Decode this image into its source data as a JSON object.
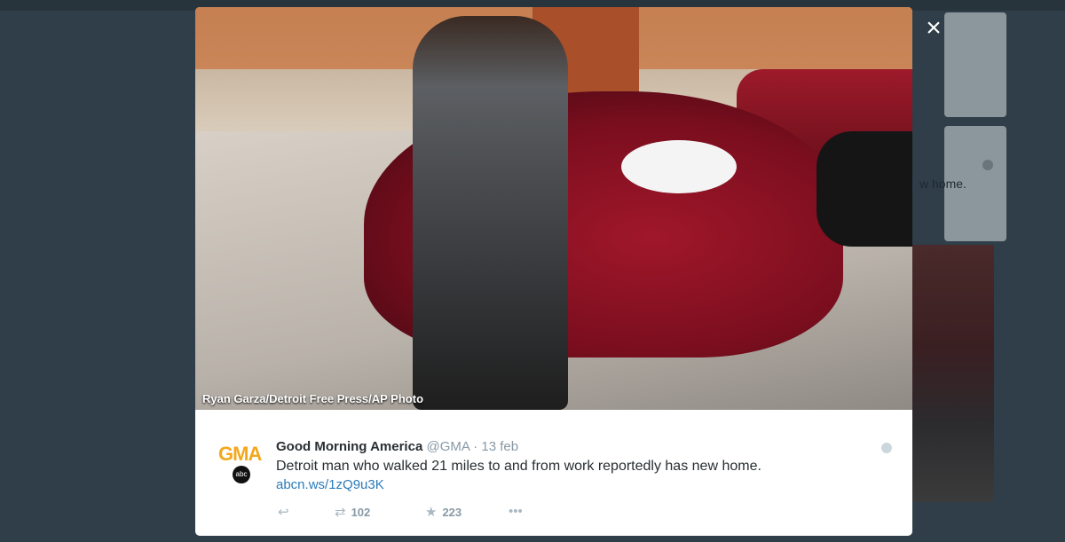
{
  "photo": {
    "caption": "Ryan Garza/Detroit Free Press/AP Photo"
  },
  "tweet": {
    "avatar_text": "GMA",
    "avatar_sub": "abc",
    "author_name": "Good Morning America",
    "handle": "@GMA",
    "separator": "·",
    "date": "13 feb",
    "text": "Detroit man who walked 21 miles to and from work reportedly has new home.",
    "link": "abcn.ws/1zQ9u3K",
    "retweet_count": "102",
    "favorite_count": "223"
  },
  "icons": {
    "close": "×",
    "reply": "↩",
    "retweet": "⇄",
    "favorite": "★",
    "more": "•••"
  },
  "background": {
    "partial_text": "w home."
  },
  "colors": {
    "backdrop": "#2f3e48",
    "link": "#2b7bb9",
    "brand_gma": "#f3a81b"
  }
}
